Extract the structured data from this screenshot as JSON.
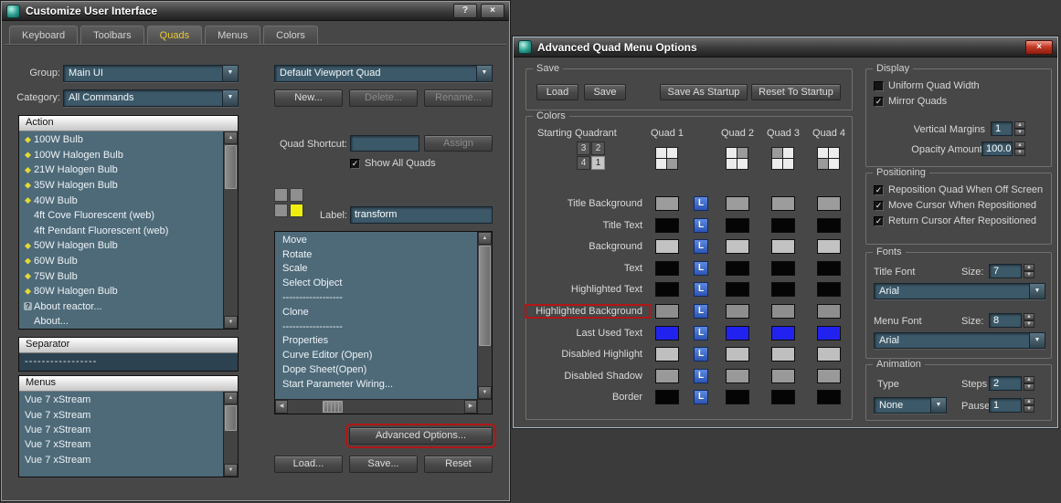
{
  "icons": {
    "help": "?",
    "close": "×",
    "dropdown_arrow": "▼",
    "spinner_up": "▲",
    "spinner_down": "▼",
    "scroll_up": "▲",
    "scroll_down": "▼",
    "scroll_left": "◀",
    "scroll_right": "▶",
    "checkmark": "✓"
  },
  "colors": {
    "active_tab_text": "#ecc832",
    "annotation_red": "#b21616",
    "l_button_blue": "#3c6ace",
    "selected_quad_yellow": "#f0ee10",
    "field_blue": "#3c5969"
  },
  "customize_window": {
    "title": "Customize User Interface",
    "titlebar": {
      "help": "?",
      "close": "×"
    },
    "tabs": [
      {
        "label": "Keyboard",
        "active": false
      },
      {
        "label": "Toolbars",
        "active": false
      },
      {
        "label": "Quads",
        "active": true
      },
      {
        "label": "Menus",
        "active": false
      },
      {
        "label": "Colors",
        "active": false
      }
    ],
    "group": {
      "label": "Group:",
      "value": "Main UI"
    },
    "category": {
      "label": "Category:",
      "value": "All Commands"
    },
    "action_list": {
      "header": "Action",
      "items": [
        {
          "label": "100W Bulb",
          "icon": "bulb"
        },
        {
          "label": "100W Halogen Bulb",
          "icon": "bulb"
        },
        {
          "label": "21W Halogen Bulb",
          "icon": "bulb"
        },
        {
          "label": "35W Halogen Bulb",
          "icon": "bulb"
        },
        {
          "label": "40W Bulb",
          "icon": "bulb"
        },
        {
          "label": "4ft Cove Fluorescent (web)",
          "icon": "none"
        },
        {
          "label": "4ft Pendant Fluorescent (web)",
          "icon": "none"
        },
        {
          "label": "50W Halogen Bulb",
          "icon": "bulb"
        },
        {
          "label": "60W Bulb",
          "icon": "bulb"
        },
        {
          "label": "75W Bulb",
          "icon": "bulb"
        },
        {
          "label": "80W Halogen Bulb",
          "icon": "bulb"
        },
        {
          "label": "About reactor...",
          "icon": "question"
        },
        {
          "label": "About...",
          "icon": "none"
        }
      ]
    },
    "separator_list": {
      "header": "Separator",
      "item": "-----------------"
    },
    "menus_list": {
      "header": "Menus",
      "items": [
        "Vue 7 xStream",
        "Vue 7 xStream",
        "Vue 7 xStream",
        "Vue 7 xStream",
        "Vue 7 xStream"
      ]
    },
    "viewport_quad_combo": "Default Viewport Quad",
    "buttons": {
      "new": "New...",
      "delete": "Delete...",
      "rename": "Rename...",
      "assign": "Assign",
      "advanced": "Advanced Options...",
      "load": "Load...",
      "save": "Save...",
      "reset": "Reset"
    },
    "quad_shortcut_label": "Quad Shortcut:",
    "quad_shortcut_value": "",
    "show_all_quads": "Show All Quads",
    "label_field": {
      "label": "Label:",
      "value": "transform"
    },
    "menu_items": [
      "Move",
      "Rotate",
      "Scale",
      "Select Object",
      "------------------",
      "Clone",
      "------------------",
      "Properties",
      "Curve Editor (Open)",
      "Dope Sheet(Open)",
      "Start Parameter Wiring..."
    ]
  },
  "advanced_window": {
    "title": "Advanced Quad Menu Options",
    "titlebar": {
      "close": "×"
    },
    "save_group": {
      "title": "Save",
      "buttons": [
        "Load",
        "Save",
        "Save As Startup",
        "Reset To Startup"
      ]
    },
    "colors_group": {
      "title": "Colors",
      "starting_quadrant_label": "Starting Quadrant",
      "quadrant_numbers": [
        "3",
        "2",
        "4",
        "1"
      ],
      "selected_quadrant": "1",
      "quad_headers": [
        "Quad 1",
        "Quad 2",
        "Quad 3",
        "Quad 4"
      ],
      "quad_icons": [
        "br",
        "tr",
        "tl",
        "bl"
      ],
      "l_button": "L",
      "rows": [
        {
          "label": "Title Background",
          "color": "#9c9c9c",
          "flagged": false
        },
        {
          "label": "Title Text",
          "color": "#050505",
          "flagged": false
        },
        {
          "label": "Background",
          "color": "#c2c2c2",
          "flagged": false
        },
        {
          "label": "Text",
          "color": "#050505",
          "flagged": false
        },
        {
          "label": "Highlighted Text",
          "color": "#050505",
          "flagged": false
        },
        {
          "label": "Highlighted Background",
          "color": "#8e8e8e",
          "flagged": true
        },
        {
          "label": "Last Used Text",
          "color": "#2222f0",
          "flagged": false
        },
        {
          "label": "Disabled Highlight",
          "color": "#bfbfbf",
          "flagged": false
        },
        {
          "label": "Disabled Shadow",
          "color": "#999999",
          "flagged": false
        },
        {
          "label": "Border",
          "color": "#050505",
          "flagged": false
        }
      ]
    },
    "display_group": {
      "title": "Display",
      "uniform_quad_width": {
        "label": "Uniform Quad Width",
        "checked": false
      },
      "mirror_quads": {
        "label": "Mirror Quads",
        "checked": true
      },
      "vertical_margins": {
        "label": "Vertical Margins",
        "value": "1"
      },
      "opacity_amount": {
        "label": "Opacity Amount:",
        "value": "100.0"
      }
    },
    "positioning_group": {
      "title": "Positioning",
      "options": [
        {
          "label": "Reposition Quad When Off Screen",
          "checked": true
        },
        {
          "label": "Move Cursor When Repositioned",
          "checked": true
        },
        {
          "label": "Return Cursor After Repositioned",
          "checked": true
        }
      ]
    },
    "fonts_group": {
      "title": "Fonts",
      "title_font": {
        "label": "Title Font",
        "size_label": "Size:",
        "size": "7",
        "font": "Arial"
      },
      "menu_font": {
        "label": "Menu Font",
        "size_label": "Size:",
        "size": "8",
        "font": "Arial"
      }
    },
    "animation_group": {
      "title": "Animation",
      "type_label": "Type",
      "type_value": "None",
      "steps_label": "Steps",
      "steps_value": "2",
      "pause_label": "Pause",
      "pause_value": "1"
    }
  }
}
